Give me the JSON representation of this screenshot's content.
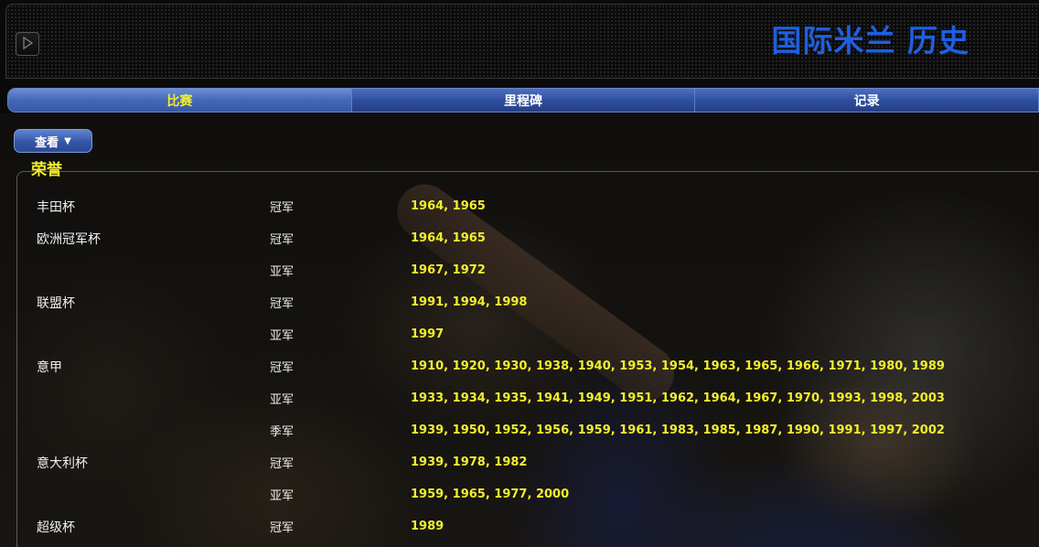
{
  "header": {
    "title": "国际米兰 历史",
    "play_icon": "play-icon"
  },
  "tabs": [
    {
      "label": "比赛",
      "active": true
    },
    {
      "label": "里程碑",
      "active": false
    },
    {
      "label": "记录",
      "active": false
    }
  ],
  "view_button": {
    "label": "查看",
    "icon": "caret-down-icon"
  },
  "honours": {
    "title": "荣誉",
    "rows": [
      {
        "competition": "丰田杯",
        "placing": "冠军",
        "years": "1964, 1965"
      },
      {
        "competition": "欧洲冠军杯",
        "placing": "冠军",
        "years": "1964, 1965"
      },
      {
        "competition": "",
        "placing": "亚军",
        "years": "1967, 1972"
      },
      {
        "competition": "联盟杯",
        "placing": "冠军",
        "years": "1991, 1994, 1998"
      },
      {
        "competition": "",
        "placing": "亚军",
        "years": "1997"
      },
      {
        "competition": "意甲",
        "placing": "冠军",
        "years": "1910, 1920, 1930, 1938, 1940, 1953, 1954, 1963, 1965, 1966, 1971, 1980, 1989"
      },
      {
        "competition": "",
        "placing": "亚军",
        "years": "1933, 1934, 1935, 1941, 1949, 1951, 1962, 1964, 1967, 1970, 1993, 1998, 2003"
      },
      {
        "competition": "",
        "placing": "季军",
        "years": "1939, 1950, 1952, 1956, 1959, 1961, 1983, 1985, 1987, 1990, 1991, 1997, 2002"
      },
      {
        "competition": "意大利杯",
        "placing": "冠军",
        "years": "1939, 1978, 1982"
      },
      {
        "competition": "",
        "placing": "亚军",
        "years": "1959, 1965, 1977, 2000"
      },
      {
        "competition": "超级杯",
        "placing": "冠军",
        "years": "1989"
      }
    ]
  },
  "colors": {
    "title_blue": "#1f5fe0",
    "accent_yellow": "#f2ee2a",
    "tab_blue": "#2f4f9e"
  }
}
